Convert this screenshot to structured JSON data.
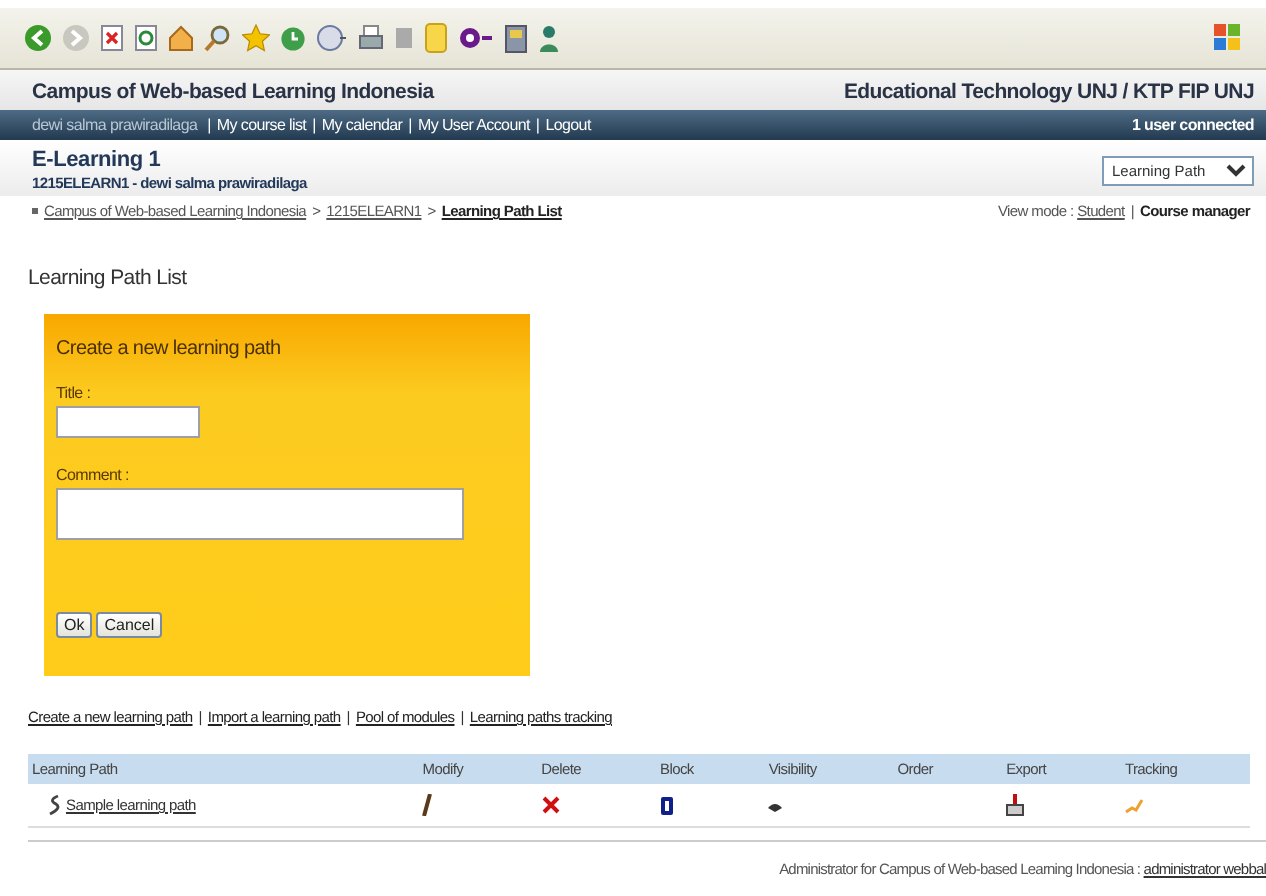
{
  "site": {
    "title": "Campus of Web-based Learning Indonesia",
    "organization": "Educational Technology UNJ / KTP FIP UNJ"
  },
  "user_bar": {
    "user": "dewi salma prawiradilaga",
    "separator": "|",
    "links": [
      "My course list",
      "My calendar",
      "My User Account",
      "Logout"
    ],
    "status": "1 user connected"
  },
  "course": {
    "title": "E-Learning 1",
    "subtitle": "1215ELEARN1 - dewi salma prawiradilaga",
    "tool_select": "Learning Path"
  },
  "breadcrumb": {
    "separator": ">",
    "items": [
      "Campus of Web-based Learning Indonesia",
      "1215ELEARN1",
      "Learning Path List"
    ]
  },
  "view_mode": {
    "label": "View mode :",
    "separator": "|",
    "options": [
      {
        "label": "Student",
        "selected": false
      },
      {
        "label": "Course manager",
        "selected": true
      }
    ]
  },
  "page_title": "Learning Path List",
  "form": {
    "title": "Create a new learning path",
    "title_label": "Title :",
    "comment_label": "Comment :",
    "buttons": [
      "Ok",
      "Cancel"
    ]
  },
  "actions": {
    "separator": "|",
    "links": [
      "Create a new learning path",
      "Import a learning path",
      "Pool of modules",
      "Learning paths tracking"
    ]
  },
  "table": {
    "columns": [
      "Learning Path",
      "Modify",
      "Delete",
      "Block",
      "Visibility",
      "Order",
      "Export",
      "Tracking"
    ],
    "rows": [
      {
        "name": "Sample learning path"
      }
    ]
  },
  "footer": {
    "text": "Administrator for Campus of Web-based Learning Indonesia :",
    "link": "administrator webbal"
  }
}
